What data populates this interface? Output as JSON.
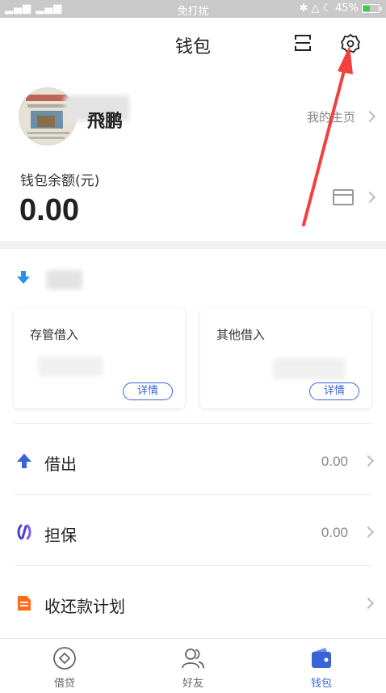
{
  "status_bar": {
    "signal": "▂▄▆ ▂▄▆",
    "center_text": "免打扰",
    "battery_percent": "45%",
    "battery_level": 0.45
  },
  "nav": {
    "title": "钱包",
    "scan_icon": "scan-icon",
    "settings_icon": "gear-icon"
  },
  "profile": {
    "name": "飛鹏",
    "my_home_label": "我的主页"
  },
  "balance": {
    "label": "钱包余额(元)",
    "value": "0.00"
  },
  "borrow_cards": [
    {
      "title": "存管借入",
      "detail_label": "详情"
    },
    {
      "title": "其他借入",
      "detail_label": "详情"
    }
  ],
  "list": [
    {
      "label": "借出",
      "value": "0.00",
      "icon": "arrow-up-icon",
      "color": "#3a63d8"
    },
    {
      "label": "担保",
      "value": "0.00",
      "icon": "guarantee-icon",
      "color": "#4a3fd1"
    },
    {
      "label": "收还款计划",
      "value": "",
      "icon": "document-icon",
      "color": "#ff6a1a"
    }
  ],
  "tabs": [
    {
      "label": "借贷",
      "icon": "diamond-icon"
    },
    {
      "label": "好友",
      "icon": "friends-icon"
    },
    {
      "label": "钱包",
      "icon": "wallet-icon",
      "active": true
    }
  ],
  "colors": {
    "accent": "#3a63d8",
    "annotation_arrow": "#f2403f"
  }
}
